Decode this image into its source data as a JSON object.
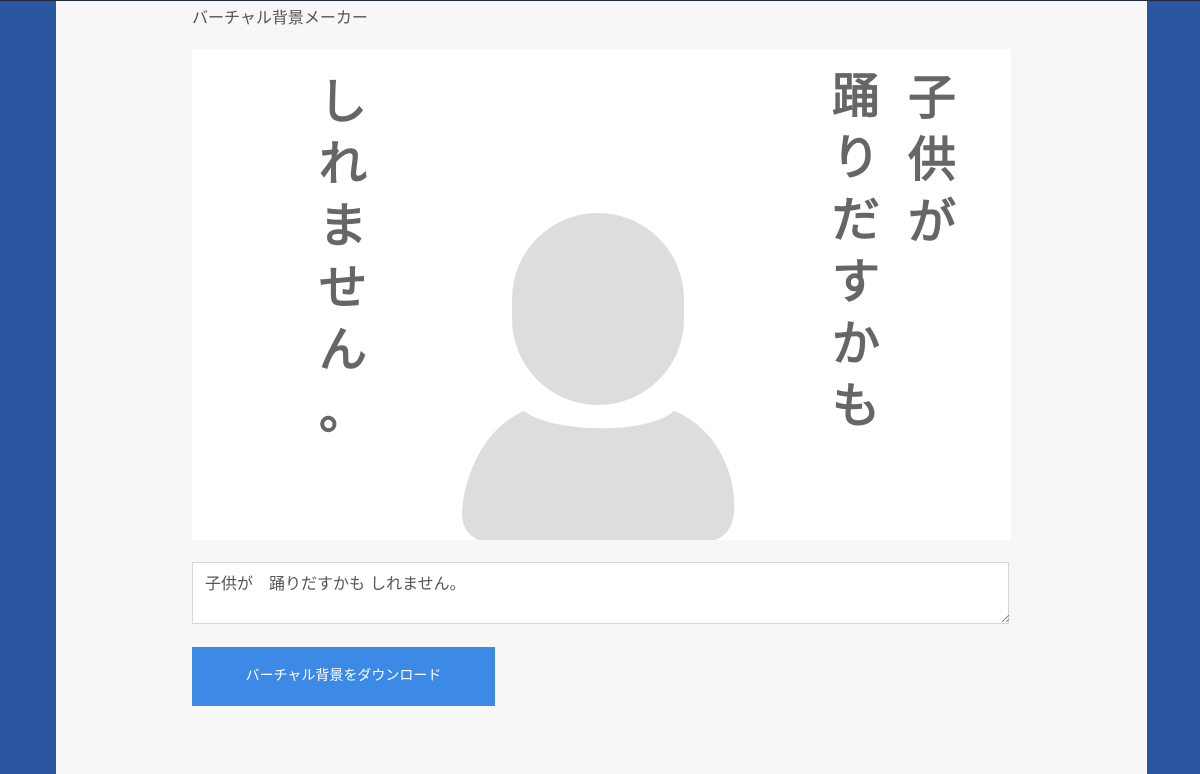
{
  "app": {
    "title": "バーチャル背景メーカー"
  },
  "preview": {
    "columns": [
      [
        "子",
        "供",
        "が"
      ],
      [
        "踊",
        "り",
        "だ",
        "す",
        "か",
        "も"
      ],
      [
        "し",
        "れ",
        "ま",
        "せ",
        "ん",
        "。"
      ]
    ],
    "avatar_icon": "person-silhouette-icon",
    "text_color": "#666666",
    "avatar_color": "#dddddd"
  },
  "message_input": {
    "value": "子供が　踊りだすかも しれません。"
  },
  "download_button": {
    "label": "バーチャル背景をダウンロード",
    "color": "#3c89e6"
  },
  "colors": {
    "outer_background": "#2a56a0",
    "page_background": "#f7f7f7"
  }
}
